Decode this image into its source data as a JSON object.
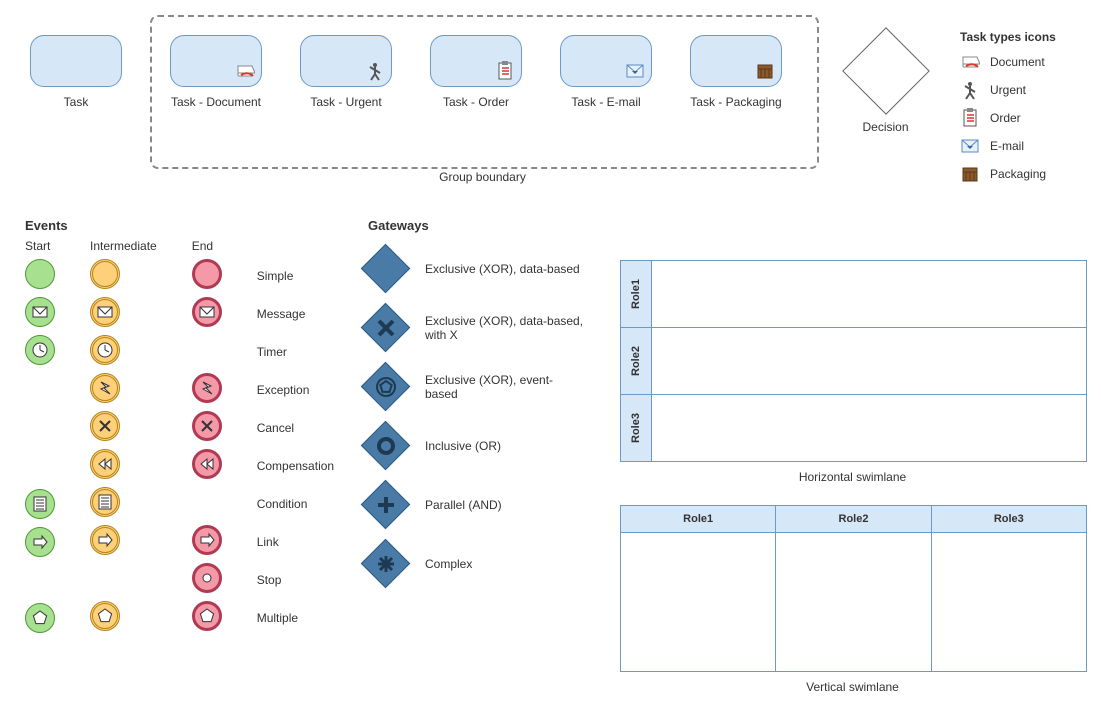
{
  "tasks": {
    "plain": "Task",
    "group_label": "Group boundary",
    "items": [
      {
        "label": "Task - Document",
        "icon": "document"
      },
      {
        "label": "Task - Urgent",
        "icon": "urgent"
      },
      {
        "label": "Task - Order",
        "icon": "order"
      },
      {
        "label": "Task - E-mail",
        "icon": "email"
      },
      {
        "label": "Task - Packaging",
        "icon": "packaging"
      }
    ]
  },
  "decision_label": "Decision",
  "legend": {
    "title": "Task types icons",
    "items": [
      {
        "label": "Document",
        "icon": "document"
      },
      {
        "label": "Urgent",
        "icon": "urgent"
      },
      {
        "label": "Order",
        "icon": "order"
      },
      {
        "label": "E-mail",
        "icon": "email"
      },
      {
        "label": "Packaging",
        "icon": "packaging"
      }
    ]
  },
  "events": {
    "title": "Events",
    "cols": {
      "start": "Start",
      "intermediate": "Intermediate",
      "end": "End"
    },
    "end_labels": [
      "Simple",
      "Message",
      "Timer",
      "Exception",
      "Cancel",
      "Compensation",
      "Condition",
      "Link",
      "Stop",
      "Multiple"
    ]
  },
  "gateways": {
    "title": "Gateways",
    "items": [
      "Exclusive (XOR), data-based",
      "Exclusive (XOR), data-based, with X",
      "Exclusive (XOR), event-based",
      "Inclusive (OR)",
      "Parallel (AND)",
      "Complex"
    ]
  },
  "swimlanes": {
    "h_label": "Horizontal swimlane",
    "v_label": "Vertical swimlane",
    "roles": [
      "Role1",
      "Role2",
      "Role3"
    ]
  }
}
